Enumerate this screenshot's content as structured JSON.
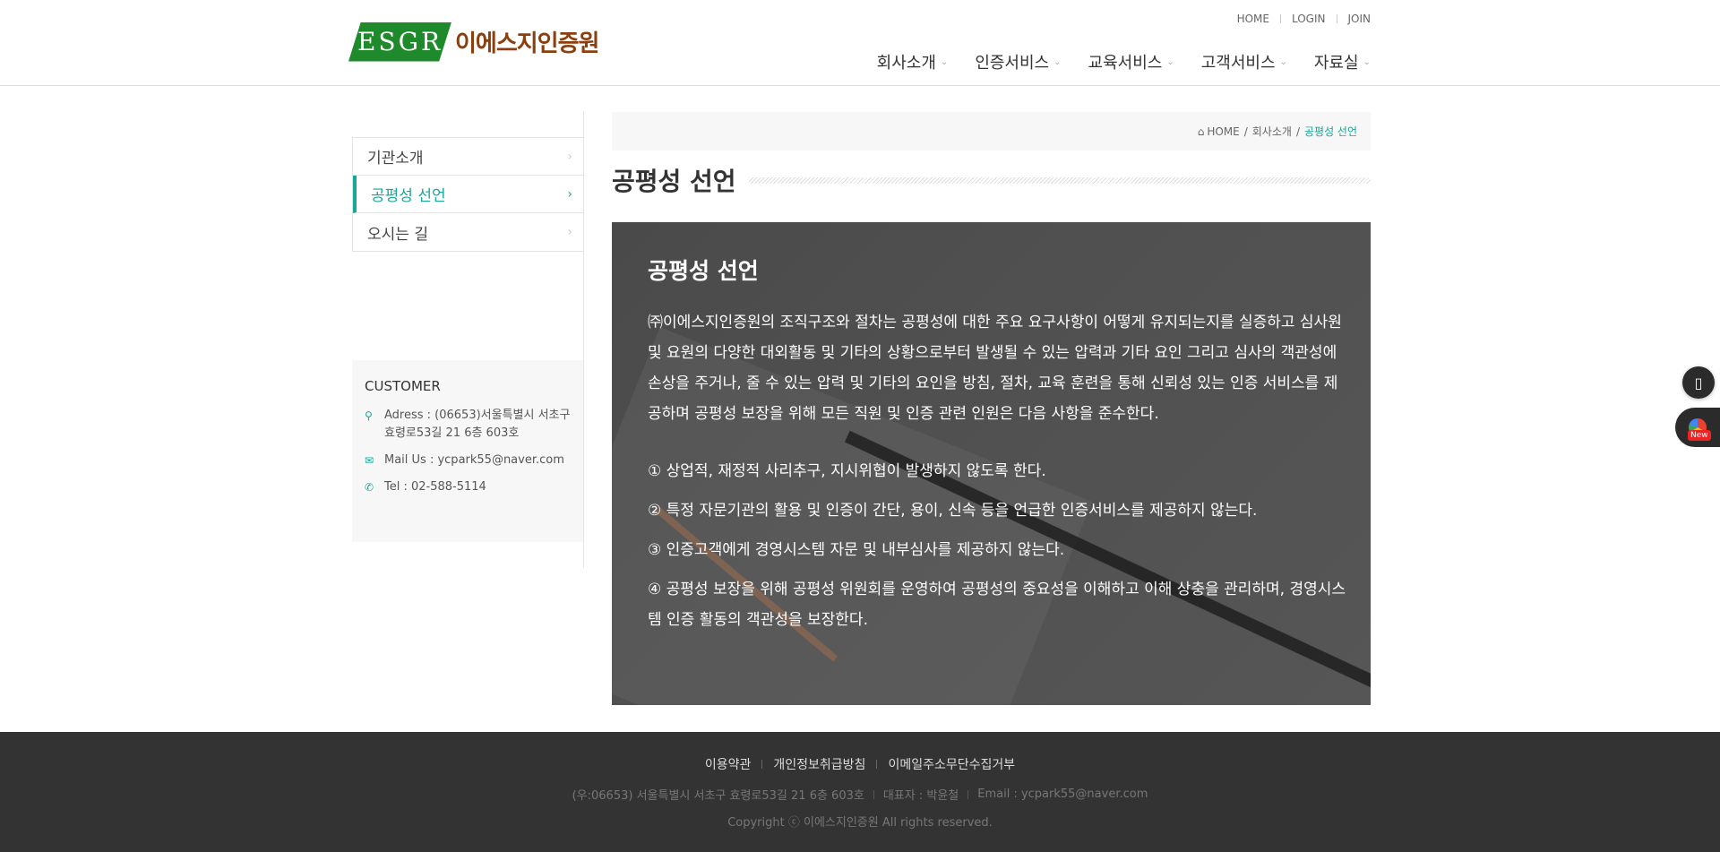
{
  "header": {
    "logo_mark": "ESGR",
    "logo_name": "이에스지인증원",
    "top_links": [
      "HOME",
      "LOGIN",
      "JOIN"
    ],
    "gnb": [
      "회사소개",
      "인증서비스",
      "교육서비스",
      "고객서비스",
      "자료실"
    ]
  },
  "sidebar": {
    "items": [
      {
        "label": "기관소개"
      },
      {
        "label": "공평성 선언"
      },
      {
        "label": "오시는 길"
      }
    ],
    "customer": {
      "title": "CUSTOMER",
      "address": "Adress : (06653)서울특별시 서초구 효령로53길 21 6층 603호",
      "mail": "Mail Us : ycpark55@naver.com",
      "tel": "Tel : 02-588-5114"
    }
  },
  "breadcrumb": {
    "home": "HOME",
    "parent": "회사소개",
    "current": "공평성 선언"
  },
  "page_title": "공평성 선언",
  "content": {
    "title": "공평성 선언",
    "intro": "㈜이에스지인증원의 조직구조와 절차는 공평성에 대한 주요 요구사항이 어떻게 유지되는지를 실증하고 심사원 및 요원의 다양한 대외활동 및 기타의 상황으로부터 발생될 수 있는 압력과 기타 요인 그리고 심사의 객관성에 손상을 주거나, 줄 수 있는 압력 및 기타의 요인을 방침, 절차, 교육 훈련을 통해 신뢰성 있는 인증 서비스를 제공하며 공평성 보장을 위해 모든 직원 및 인증 관련 인원은 다음 사항을 준수한다.",
    "items": [
      "① 상업적, 재정적 사리추구, 지시위협이 발생하지 않도록 한다.",
      "② 특정 자문기관의 활용 및 인증이 간단, 용이, 신속 등을 언급한 인증서비스를 제공하지 않는다.",
      "③ 인증고객에게 경영시스템 자문 및 내부심사를 제공하지 않는다.",
      "④ 공평성 보장을 위해 공평성 위원회를 운영하여 공평성의 중요성을 이해하고 이해 상충을 관리하며, 경영시스템 인증 활동의 객관성을 보장한다."
    ]
  },
  "float": {
    "new_badge": "New"
  },
  "footer": {
    "links": [
      "이용약관",
      "개인정보취급방침",
      "이메일주소무단수집거부"
    ],
    "address": "(우:06653) 서울특별시 서초구 효령로53길 21 6층 603호",
    "ceo": "대표자 : 박윤철",
    "email": "Email : ycpark55@naver.com",
    "copyright": "Copyright ⓒ 이에스지인증원 All rights reserved."
  },
  "colors": {
    "accent": "#1aa795",
    "logo_green": "#1f8a2b",
    "logo_brown": "#8b3f0f",
    "footer_bg": "#333333"
  }
}
